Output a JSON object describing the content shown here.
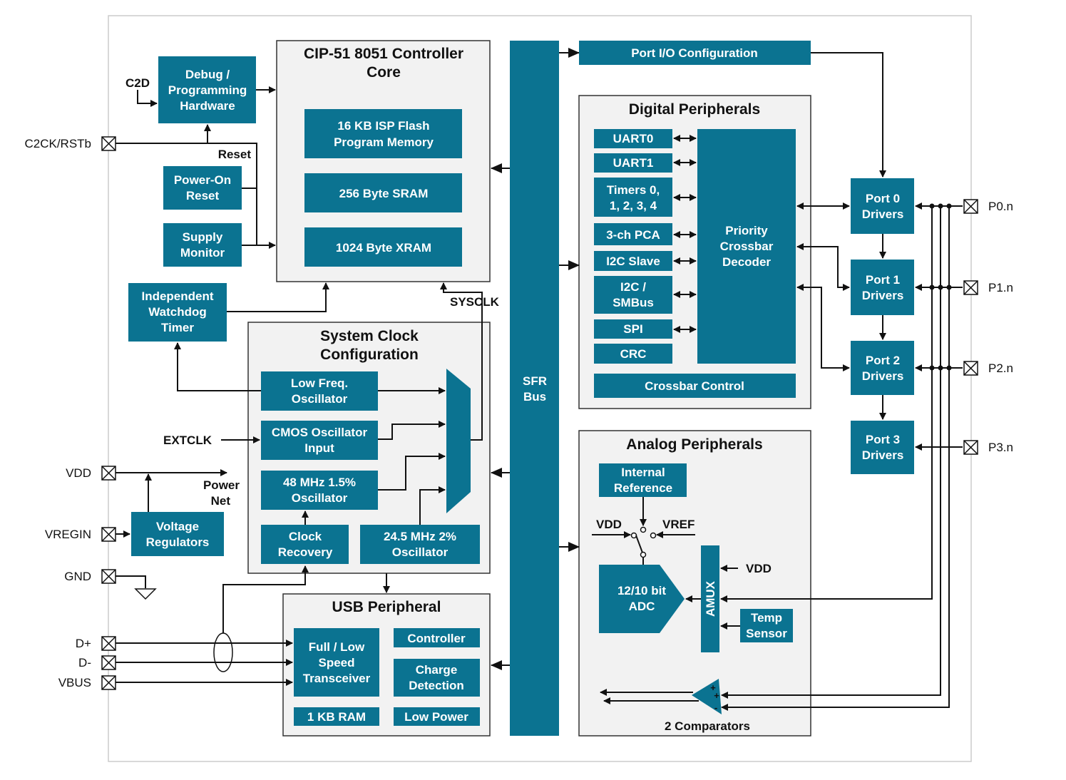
{
  "colors": {
    "block": "#0b7391",
    "container": "#f2f2f2",
    "frame": "#cccccc"
  },
  "core": {
    "title": [
      "CIP-51 8051 Controller",
      "Core"
    ],
    "flash": [
      "16 KB ISP Flash",
      "Program Memory"
    ],
    "sram": "256 Byte SRAM",
    "xram": "1024 Byte XRAM"
  },
  "left": {
    "debug": [
      "Debug /",
      "Programming",
      "Hardware"
    ],
    "por": [
      "Power-On",
      "Reset"
    ],
    "supply": [
      "Supply",
      "Monitor"
    ],
    "watchdog": [
      "Independent",
      "Watchdog",
      "Timer"
    ],
    "vreg": [
      "Voltage",
      "Regulators"
    ]
  },
  "clock": {
    "title": [
      "System Clock",
      "Configuration"
    ],
    "lfo": [
      "Low Freq.",
      "Oscillator"
    ],
    "cmos": [
      "CMOS Oscillator",
      "Input"
    ],
    "osc48": [
      "48 MHz 1.5%",
      "Oscillator"
    ],
    "recovery": [
      "Clock",
      "Recovery"
    ],
    "osc24": [
      "24.5 MHz 2%",
      "Oscillator"
    ]
  },
  "usb": {
    "title": "USB Peripheral",
    "transceiver": [
      "Full / Low",
      "Speed",
      "Transceiver"
    ],
    "controller": "Controller",
    "charge": [
      "Charge",
      "Detection"
    ],
    "ram": "1 KB RAM",
    "lowpower": "Low Power"
  },
  "sfr": [
    "SFR",
    "Bus"
  ],
  "portio": "Port I/O Configuration",
  "digital": {
    "title": "Digital Peripherals",
    "uart0": "UART0",
    "uart1": "UART1",
    "timers": [
      "Timers 0,",
      "1, 2, 3, 4"
    ],
    "pca": "3-ch PCA",
    "i2cslave": "I2C Slave",
    "smbus": [
      "I2C /",
      "SMBus"
    ],
    "spi": "SPI",
    "crc": "CRC",
    "crossbar": [
      "Priority",
      "Crossbar",
      "Decoder"
    ],
    "control": "Crossbar Control"
  },
  "analog": {
    "title": "Analog Peripherals",
    "ref": [
      "Internal",
      "Reference"
    ],
    "vdd": "VDD",
    "vref": "VREF",
    "adc": [
      "12/10 bit",
      "ADC"
    ],
    "amux": "AMUX",
    "vdd2": "VDD",
    "temp": [
      "Temp",
      "Sensor"
    ],
    "comparators": "2 Comparators",
    "plus1": "+",
    "plus2": "+",
    "minus": "-"
  },
  "ports": {
    "p0": [
      "Port 0",
      "Drivers"
    ],
    "p1": [
      "Port 1",
      "Drivers"
    ],
    "p2": [
      "Port 2",
      "Drivers"
    ],
    "p3": [
      "Port 3",
      "Drivers"
    ]
  },
  "signals": {
    "c2d": "C2D",
    "reset": "Reset",
    "extclk": "EXTCLK",
    "powernet": [
      "Power",
      "Net"
    ],
    "sysclk": "SYSCLK"
  },
  "pins": {
    "c2ck": "C2CK/RSTb",
    "vdd": "VDD",
    "vregin": "VREGIN",
    "gnd": "GND",
    "dplus": "D+",
    "dminus": "D-",
    "vbus": "VBUS",
    "p0": "P0.n",
    "p1": "P1.n",
    "p2": "P2.n",
    "p3": "P3.n"
  }
}
